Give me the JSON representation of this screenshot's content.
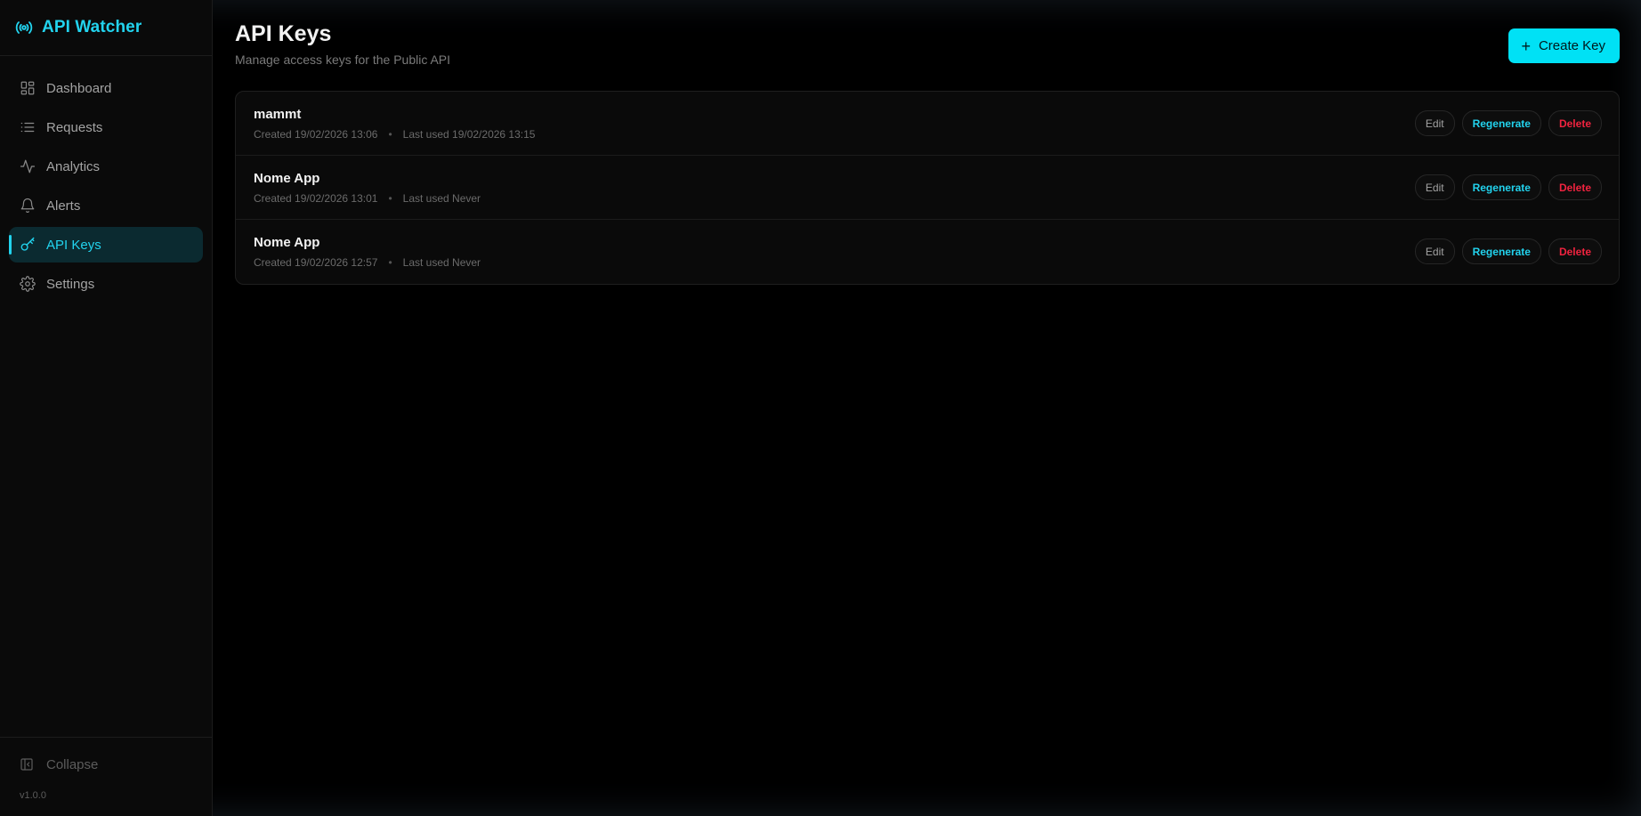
{
  "app": {
    "title": "API Watcher",
    "version": "v1.0.0",
    "accent": "#22d3ee"
  },
  "sidebar": {
    "items": [
      {
        "label": "Dashboard",
        "icon": "dashboard-icon"
      },
      {
        "label": "Requests",
        "icon": "list-icon"
      },
      {
        "label": "Analytics",
        "icon": "activity-icon"
      },
      {
        "label": "Alerts",
        "icon": "bell-icon"
      },
      {
        "label": "API Keys",
        "icon": "key-icon",
        "active": true
      },
      {
        "label": "Settings",
        "icon": "gear-icon"
      }
    ],
    "collapse_label": "Collapse"
  },
  "page": {
    "title": "API Keys",
    "subtitle": "Manage access keys for the Public API",
    "create_label": "Create Key"
  },
  "keys": [
    {
      "name": "mammt",
      "created": "Created 19/02/2026 13:06",
      "last_used": "Last used 19/02/2026 13:15"
    },
    {
      "name": "Nome App",
      "created": "Created 19/02/2026 13:01",
      "last_used": "Last used Never"
    },
    {
      "name": "Nome App",
      "created": "Created 19/02/2026 12:57",
      "last_used": "Last used Never"
    }
  ],
  "actions": {
    "edit": "Edit",
    "regenerate": "Regenerate",
    "delete": "Delete"
  },
  "colors": {
    "regenerate": "#22d3ee",
    "delete": "#f0233f",
    "create_button": "#00e1f5"
  }
}
